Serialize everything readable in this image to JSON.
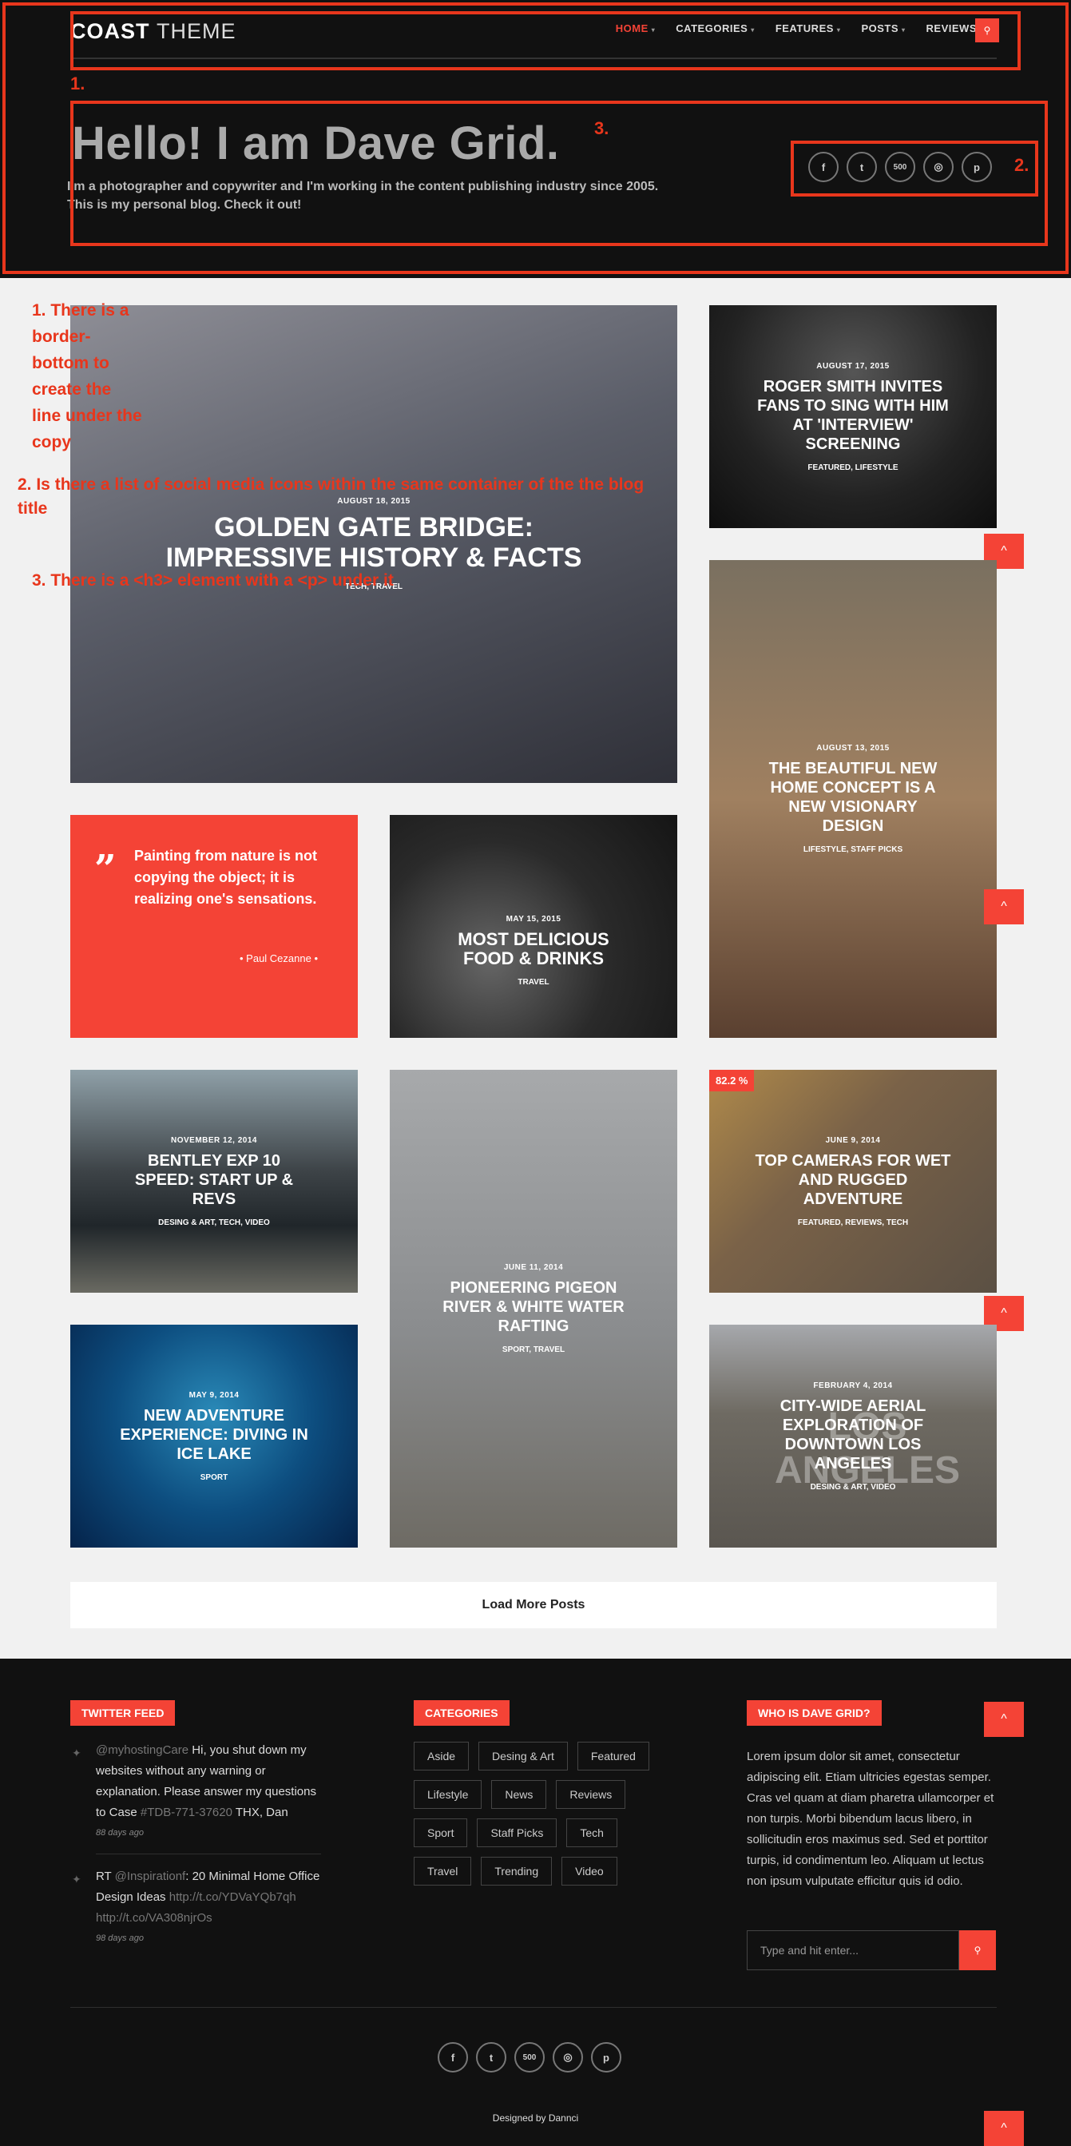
{
  "header": {
    "logo_bold": "COAST",
    "logo_light": "THEME",
    "nav": [
      {
        "label": "HOME",
        "caret": "▾"
      },
      {
        "label": "CATEGORIES",
        "caret": "▾"
      },
      {
        "label": "FEATURES",
        "caret": "▾"
      },
      {
        "label": "POSTS",
        "caret": "▾"
      },
      {
        "label": "REVIEWS",
        "caret": ""
      }
    ],
    "search_glyph": "⚲",
    "hero_title": "Hello! I am Dave Grid.",
    "hero_desc": "I'm a photographer and copywriter and I'm working in the content publishing industry since 2005. This is my personal blog. Check it out!",
    "socials": [
      {
        "icon": "facebook-icon",
        "glyph": "f"
      },
      {
        "icon": "twitter-icon",
        "glyph": "t"
      },
      {
        "icon": "500px-icon",
        "glyph": "500"
      },
      {
        "icon": "instagram-icon",
        "glyph": "◎"
      },
      {
        "icon": "pinterest-icon",
        "glyph": "p"
      }
    ]
  },
  "annotations": {
    "n1": "1.",
    "n2": "2.",
    "n3": "3.",
    "note1": "1. There  is a border-bottom to create the line under the copy",
    "note2": "2.  Is there a list of social media icons within the same container of the the blog title",
    "note3": "3. There is a <h3> element with a <p> under it"
  },
  "posts": {
    "golden_gate": {
      "date": "AUGUST 18, 2015",
      "title": "GOLDEN GATE BRIDGE: IMPRESSIVE HISTORY & FACTS",
      "cats": "TECH, TRAVEL"
    },
    "roger": {
      "date": "AUGUST 17, 2015",
      "title": "ROGER SMITH INVITES FANS TO SING WITH HIM AT 'INTERVIEW' SCREENING",
      "cats": "FEATURED, LIFESTYLE"
    },
    "home": {
      "date": "AUGUST 13, 2015",
      "title": "THE BEAUTIFUL NEW HOME CONCEPT IS A NEW VISIONARY DESIGN",
      "cats": "LIFESTYLE, STAFF PICKS"
    },
    "food": {
      "date": "MAY 15, 2015",
      "title": "MOST DELICIOUS FOOD & DRINKS",
      "cats": "TRAVEL"
    },
    "bentley": {
      "date": "NOVEMBER 12, 2014",
      "title": "BENTLEY EXP 10 SPEED: START UP & REVS",
      "cats": "DESING & ART, TECH, VIDEO"
    },
    "pigeon": {
      "date": "JUNE 11, 2014",
      "title": "PIONEERING PIGEON RIVER & WHITE WATER RAFTING",
      "cats": "SPORT, TRAVEL"
    },
    "cameras": {
      "date": "JUNE 9, 2014",
      "title": "TOP CAMERAS FOR WET AND RUGGED ADVENTURE",
      "cats": "FEATURED, REVIEWS, TECH",
      "badge": "82.2 %"
    },
    "ice": {
      "date": "MAY 9, 2014",
      "title": "NEW ADVENTURE EXPERIENCE: DIVING IN ICE LAKE",
      "cats": "SPORT"
    },
    "la": {
      "date": "FEBRUARY 4, 2014",
      "title": "CITY-WIDE AERIAL EXPLORATION OF DOWNTOWN LOS ANGELES",
      "cats": "DESING & ART, VIDEO",
      "overlay": "LOS ANGELES"
    }
  },
  "quote": {
    "mark": "”",
    "text": "Painting from nature is not copying the object; it is realizing one's sensations.",
    "author": "• Paul Cezanne •"
  },
  "up_glyph": "^",
  "load_more": "Load More Posts",
  "footer": {
    "twitter_title": "TWITTER FEED",
    "tweets": [
      {
        "handle": "@myhostingCare",
        "text": " Hi, you shut down my websites without any warning or explanation. Please answer my questions to Case ",
        "ref": "#TDB-771-37620",
        "tail": " THX, Dan",
        "time": "88 days ago"
      },
      {
        "prefix": "RT ",
        "handle": "@Inspirationf",
        "text": ": 20 Minimal Home Office Design Ideas ",
        "link1": "http://t.co/YDVaYQb7qh",
        "link2": "http://t.co/VA308njrOs",
        "time": "98 days ago"
      }
    ],
    "categories_title": "CATEGORIES",
    "categories": [
      "Aside",
      "Desing & Art",
      "Featured",
      "Lifestyle",
      "News",
      "Reviews",
      "Sport",
      "Staff Picks",
      "Tech",
      "Travel",
      "Trending",
      "Video"
    ],
    "about_title": "WHO IS DAVE GRID?",
    "about_text": "Lorem ipsum dolor sit amet, consectetur adipiscing elit. Etiam ultricies egestas semper. Cras vel quam at diam pharetra ullamcorper et non turpis. Morbi bibendum lacus libero, in sollicitudin eros maximus sed. Sed et porttitor turpis, id condimentum leo. Aliquam ut lectus non ipsum vulputate efficitur quis id odio.",
    "search_placeholder": "Type and hit enter...",
    "credit": "Designed by Dannci"
  },
  "colors": {
    "accent": "#f44336",
    "dark": "#111111",
    "annotation": "#e8361c"
  }
}
